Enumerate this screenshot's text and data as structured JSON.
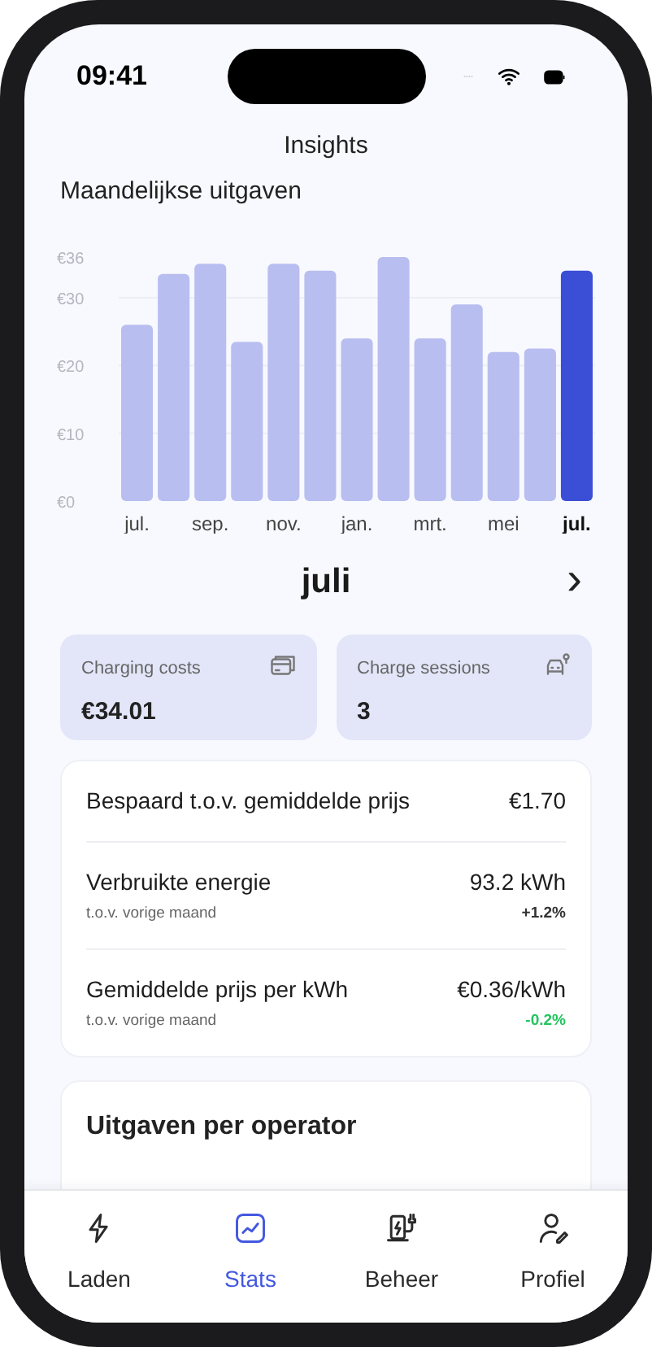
{
  "status_bar": {
    "time": "09:41"
  },
  "header": {
    "title": "Insights"
  },
  "chart": {
    "section_title": "Maandelijkse uitgaven",
    "chart_data": {
      "type": "bar",
      "stacked": true,
      "grid": true,
      "categories": [
        "jul.",
        null,
        "sep.",
        null,
        "nov.",
        null,
        "jan.",
        null,
        "mrt.",
        null,
        "mei",
        null,
        "jul."
      ],
      "series": [
        {
          "color": "#b8bef0",
          "values": [
            26,
            33.5,
            35,
            23.5,
            35,
            34,
            24,
            36,
            24,
            29,
            22,
            22.5,
            null
          ]
        },
        {
          "color": "#3a4fd6",
          "values": [
            null,
            null,
            null,
            null,
            null,
            null,
            null,
            null,
            null,
            null,
            null,
            null,
            34
          ]
        }
      ],
      "ylim": [
        0,
        36
      ],
      "yticks": [
        {
          "value": 0,
          "label": "€0"
        },
        {
          "value": 10,
          "label": "€10"
        },
        {
          "value": 20,
          "label": "€20"
        },
        {
          "value": 30,
          "label": "€30"
        },
        {
          "value": 36,
          "label": "€36"
        }
      ]
    }
  },
  "month_nav": {
    "month": "juli",
    "next": "›"
  },
  "summary_cards": [
    {
      "label": "Charging costs",
      "value": "€34.01"
    },
    {
      "label": "Charge sessions",
      "value": "3"
    }
  ],
  "stats": [
    {
      "label": "Bespaard t.o.v. gemiddelde prijs",
      "value": "€1.70"
    },
    {
      "label": "Verbruikte energie",
      "sublabel": "t.o.v. vorige maand",
      "value": "93.2 kWh",
      "change": "+1.2%",
      "color": "#333333"
    },
    {
      "label": "Gemiddelde prijs per kWh",
      "sublabel": "t.o.v. vorige maand",
      "value": "€0.36/kWh",
      "change": "-0.2%",
      "color": "#22c55e"
    }
  ],
  "operators": {
    "title": "Uitgaven per operator"
  },
  "tab_bar": [
    {
      "label": "Laden",
      "selected": false
    },
    {
      "label": "Stats",
      "selected": true
    },
    {
      "label": "Beheer",
      "selected": false
    },
    {
      "label": "Profiel",
      "selected": false
    }
  ]
}
